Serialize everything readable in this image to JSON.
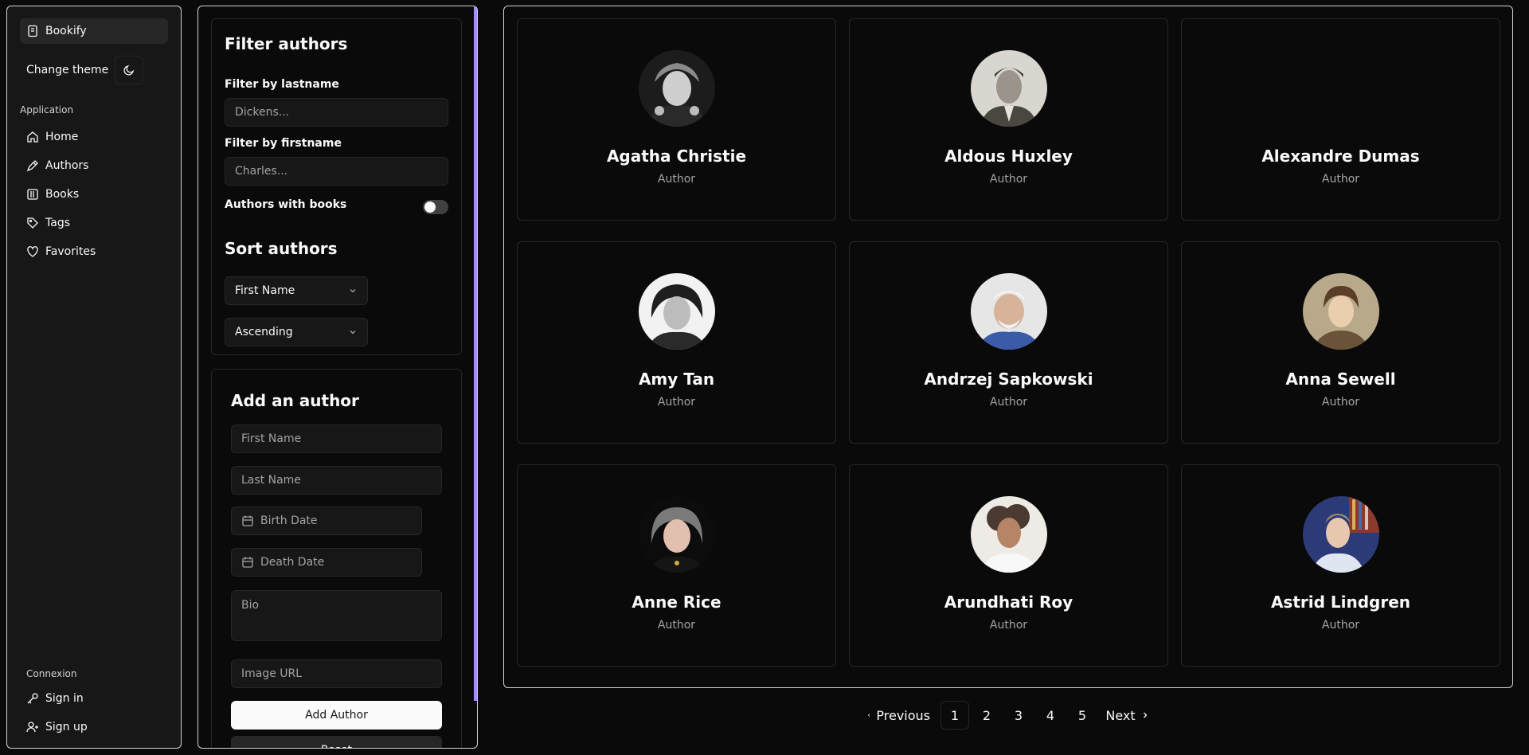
{
  "sidebar": {
    "brand": "Bookify",
    "change_theme": "Change theme",
    "application_label": "Application",
    "nav": [
      {
        "label": "Home",
        "icon": "home-icon"
      },
      {
        "label": "Authors",
        "icon": "pen-icon"
      },
      {
        "label": "Books",
        "icon": "library-icon"
      },
      {
        "label": "Tags",
        "icon": "tag-icon"
      },
      {
        "label": "Favorites",
        "icon": "heart-icon"
      }
    ],
    "connexion_label": "Connexion",
    "sign_in": "Sign in",
    "sign_up": "Sign up"
  },
  "filter": {
    "title": "Filter authors",
    "lastname_label": "Filter by lastname",
    "lastname_placeholder": "Dickens...",
    "firstname_label": "Filter by firstname",
    "firstname_placeholder": "Charles...",
    "with_books_label": "Authors with books",
    "with_books_enabled": false,
    "sort_title": "Sort authors",
    "sort_field": "First Name",
    "sort_order": "Ascending"
  },
  "add_author": {
    "title": "Add an author",
    "first_name_placeholder": "First Name",
    "last_name_placeholder": "Last Name",
    "birth_date": "Birth Date",
    "death_date": "Death Date",
    "bio_placeholder": "Bio",
    "image_url_placeholder": "Image URL",
    "submit": "Add Author",
    "reset": "Reset"
  },
  "authors": [
    {
      "name": "Agatha Christie",
      "role": "Author"
    },
    {
      "name": "Aldous Huxley",
      "role": "Author"
    },
    {
      "name": "Alexandre Dumas",
      "role": "Author"
    },
    {
      "name": "Amy Tan",
      "role": "Author"
    },
    {
      "name": "Andrzej Sapkowski",
      "role": "Author"
    },
    {
      "name": "Anna Sewell",
      "role": "Author"
    },
    {
      "name": "Anne Rice",
      "role": "Author"
    },
    {
      "name": "Arundhati Roy",
      "role": "Author"
    },
    {
      "name": "Astrid Lindgren",
      "role": "Author"
    }
  ],
  "pagination": {
    "previous": "Previous",
    "pages": [
      "1",
      "2",
      "3",
      "4",
      "5"
    ],
    "current": "1",
    "next": "Next"
  },
  "colors": {
    "background": "#0a0a0a",
    "panel": "#171717",
    "border": "#262626",
    "frame_border": "#d4d4d4",
    "scrollbar": "#a78bfa",
    "muted_text": "#a3a3a3"
  }
}
